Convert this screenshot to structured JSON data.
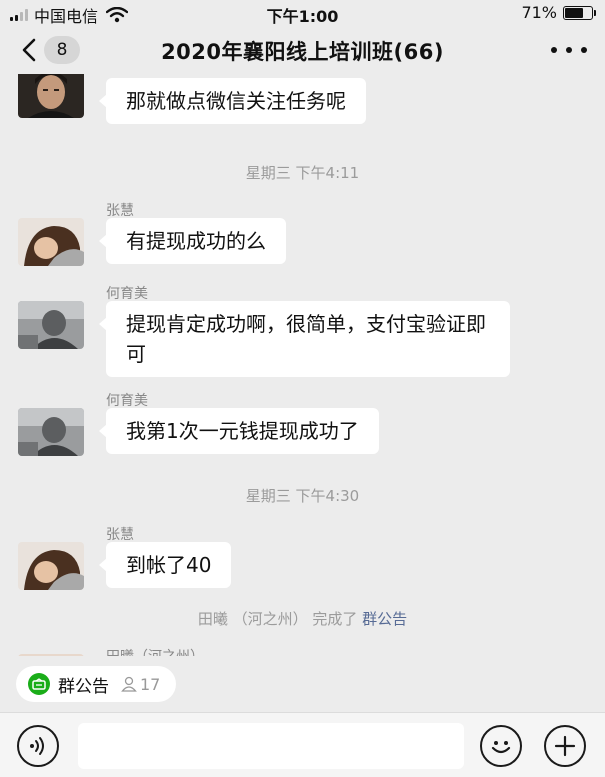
{
  "status_bar": {
    "carrier": "中国电信",
    "time": "下午1:00",
    "battery_percent": "71%",
    "battery_level": 0.71,
    "signal_bars_on": 2,
    "signal_bars_total": 4
  },
  "nav": {
    "unread_count": "8",
    "title": "2020年襄阳线上培训班(66)"
  },
  "messages": [
    {
      "sender": "",
      "text": "那就做点微信关注任务呢",
      "avatar": "avatar-man"
    },
    {
      "sender": "张慧",
      "text": "有提现成功的么",
      "avatar": "avatar-woman"
    },
    {
      "sender": "何育美",
      "text": "提现肯定成功啊，很简单，支付宝验证即可",
      "avatar": "avatar-grey"
    },
    {
      "sender": "何育美",
      "text": "我第1次一元钱提现成功了",
      "avatar": "avatar-grey"
    },
    {
      "sender": "张慧",
      "text": "到帐了40",
      "avatar": "avatar-woman"
    }
  ],
  "timestamps": [
    "星期三 下午4:11",
    "星期三 下午4:30"
  ],
  "system_message": {
    "prefix": "田曦 （河之州） 完成了",
    "link": "群公告"
  },
  "partial_sender": "田曦（河之州）",
  "announcement": {
    "label": "群公告",
    "count": "17"
  },
  "input": {
    "value": "",
    "placeholder": ""
  },
  "colors": {
    "background": "#ececec",
    "bubble": "#ffffff",
    "link": "#576b95",
    "accent_green": "#1aad19"
  }
}
